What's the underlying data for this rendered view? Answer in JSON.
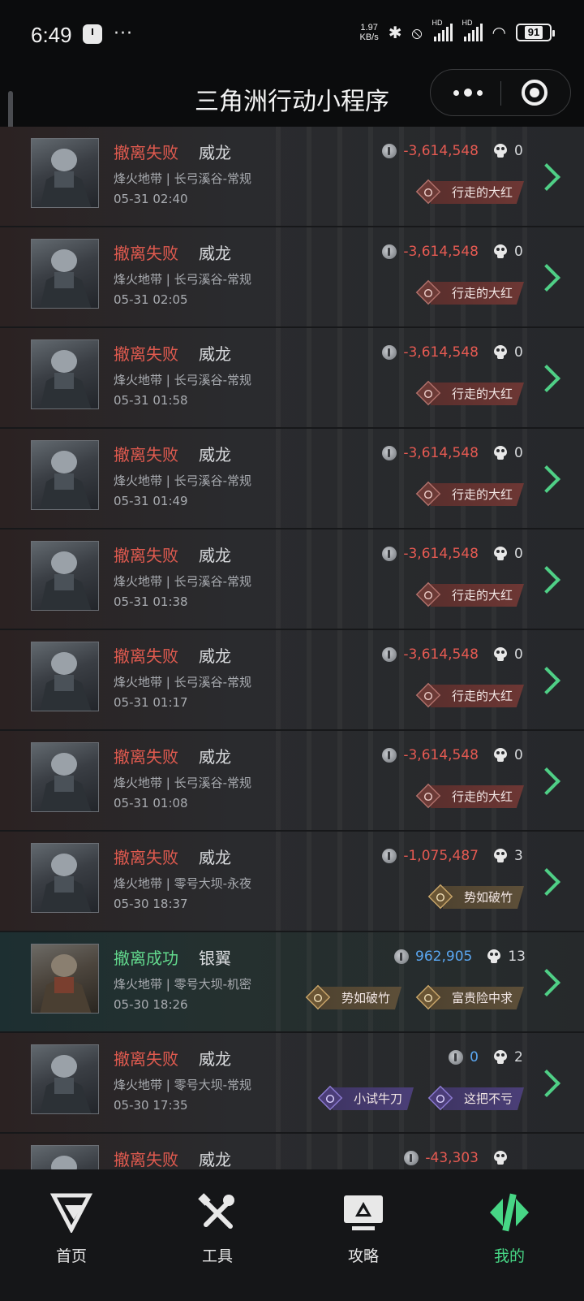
{
  "status_bar": {
    "time": "6:49",
    "more": "···",
    "speed_value": "1.97",
    "speed_unit": "KB/s",
    "hd": "HD",
    "battery": "91"
  },
  "title_bar": {
    "title": "三角洲行动小程序"
  },
  "records": [
    {
      "status": "撤离失败",
      "success": false,
      "operator": "威龙",
      "map": "烽火地带 | 长弓溪谷-常规",
      "time": "05-31 02:40",
      "value": "-3,614,548",
      "value_type": "neg",
      "kills": "0",
      "badges": [
        {
          "label": "行走的大红",
          "style": "red"
        }
      ]
    },
    {
      "status": "撤离失败",
      "success": false,
      "operator": "威龙",
      "map": "烽火地带 | 长弓溪谷-常规",
      "time": "05-31 02:05",
      "value": "-3,614,548",
      "value_type": "neg",
      "kills": "0",
      "badges": [
        {
          "label": "行走的大红",
          "style": "red"
        }
      ]
    },
    {
      "status": "撤离失败",
      "success": false,
      "operator": "威龙",
      "map": "烽火地带 | 长弓溪谷-常规",
      "time": "05-31 01:58",
      "value": "-3,614,548",
      "value_type": "neg",
      "kills": "0",
      "badges": [
        {
          "label": "行走的大红",
          "style": "red"
        }
      ]
    },
    {
      "status": "撤离失败",
      "success": false,
      "operator": "威龙",
      "map": "烽火地带 | 长弓溪谷-常规",
      "time": "05-31 01:49",
      "value": "-3,614,548",
      "value_type": "neg",
      "kills": "0",
      "badges": [
        {
          "label": "行走的大红",
          "style": "red"
        }
      ]
    },
    {
      "status": "撤离失败",
      "success": false,
      "operator": "威龙",
      "map": "烽火地带 | 长弓溪谷-常规",
      "time": "05-31 01:38",
      "value": "-3,614,548",
      "value_type": "neg",
      "kills": "0",
      "badges": [
        {
          "label": "行走的大红",
          "style": "red"
        }
      ]
    },
    {
      "status": "撤离失败",
      "success": false,
      "operator": "威龙",
      "map": "烽火地带 | 长弓溪谷-常规",
      "time": "05-31 01:17",
      "value": "-3,614,548",
      "value_type": "neg",
      "kills": "0",
      "badges": [
        {
          "label": "行走的大红",
          "style": "red"
        }
      ]
    },
    {
      "status": "撤离失败",
      "success": false,
      "operator": "威龙",
      "map": "烽火地带 | 长弓溪谷-常规",
      "time": "05-31 01:08",
      "value": "-3,614,548",
      "value_type": "neg",
      "kills": "0",
      "badges": [
        {
          "label": "行走的大红",
          "style": "red"
        }
      ]
    },
    {
      "status": "撤离失败",
      "success": false,
      "operator": "威龙",
      "map": "烽火地带 | 零号大坝-永夜",
      "time": "05-30 18:37",
      "value": "-1,075,487",
      "value_type": "neg",
      "kills": "3",
      "badges": [
        {
          "label": "势如破竹",
          "style": "gold"
        }
      ]
    },
    {
      "status": "撤离成功",
      "success": true,
      "operator": "银翼",
      "map": "烽火地带 | 零号大坝-机密",
      "time": "05-30 18:26",
      "value": "962,905",
      "value_type": "pos",
      "kills": "13",
      "badges": [
        {
          "label": "势如破竹",
          "style": "gold"
        },
        {
          "label": "富贵险中求",
          "style": "gold"
        }
      ]
    },
    {
      "status": "撤离失败",
      "success": false,
      "operator": "威龙",
      "map": "烽火地带 | 零号大坝-常规",
      "time": "05-30 17:35",
      "value": "0",
      "value_type": "zero",
      "kills": "2",
      "badges": [
        {
          "label": "小试牛刀",
          "style": "purple"
        },
        {
          "label": "这把不亏",
          "style": "purple"
        }
      ]
    },
    {
      "status": "撤离失败",
      "success": false,
      "operator": "威龙",
      "map": "",
      "time": "",
      "value": "-43,303",
      "value_type": "neg",
      "kills": "",
      "badges": []
    }
  ],
  "tabs": [
    {
      "label": "首页",
      "icon": "home-logo-icon",
      "active": false
    },
    {
      "label": "工具",
      "icon": "tools-icon",
      "active": false
    },
    {
      "label": "攻略",
      "icon": "guide-monitor-icon",
      "active": false
    },
    {
      "label": "我的",
      "icon": "profile-logo-icon",
      "active": true
    }
  ],
  "colors": {
    "fail": "#e05a4f",
    "success": "#62d98d",
    "accent": "#47d685",
    "negative_value": "#e65a52",
    "positive_value": "#5aa6f0"
  }
}
